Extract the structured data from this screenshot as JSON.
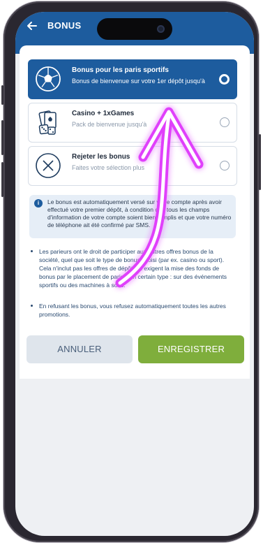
{
  "header": {
    "title": "BONUS"
  },
  "options": [
    {
      "title": "Bonus pour les paris sportifs",
      "desc": "Bonus de bienvenue sur votre 1er dépôt jusqu'à",
      "selected": true,
      "icon": "soccer-ball-icon"
    },
    {
      "title": "Casino + 1xGames",
      "desc": "Pack de bienvenue jusqu'à",
      "selected": false,
      "icon": "cards-dice-icon"
    },
    {
      "title": "Rejeter les bonus",
      "desc": "Faites votre sélection plus",
      "selected": false,
      "icon": "close-circle-icon"
    }
  ],
  "info": {
    "text": "Le bonus est automatiquement versé sur votre compte après avoir effectué votre premier dépôt, à condition que tous les champs d'information de votre compte soient bien remplis et que votre numéro de téléphone ait été confirmé par SMS."
  },
  "bullets": [
    "Les parieurs ont le droit de participer aux autres offres bonus de la société, quel que soit le type de bonus choisi (par ex. casino ou sport). Cela n'inclut pas les offres de dépôt qui exigent la mise des fonds de bonus par le placement de paris d'un certain type : sur des événements sportifs ou des machines à sous.",
    "En refusant les bonus, vous refusez automatiquement toutes les autres promotions."
  ],
  "buttons": {
    "cancel": "ANNULER",
    "save": "ENREGISTRER"
  },
  "colors": {
    "primary": "#1d5c9e",
    "accent_green": "#7fae3c",
    "arrow": "#e040fb"
  }
}
